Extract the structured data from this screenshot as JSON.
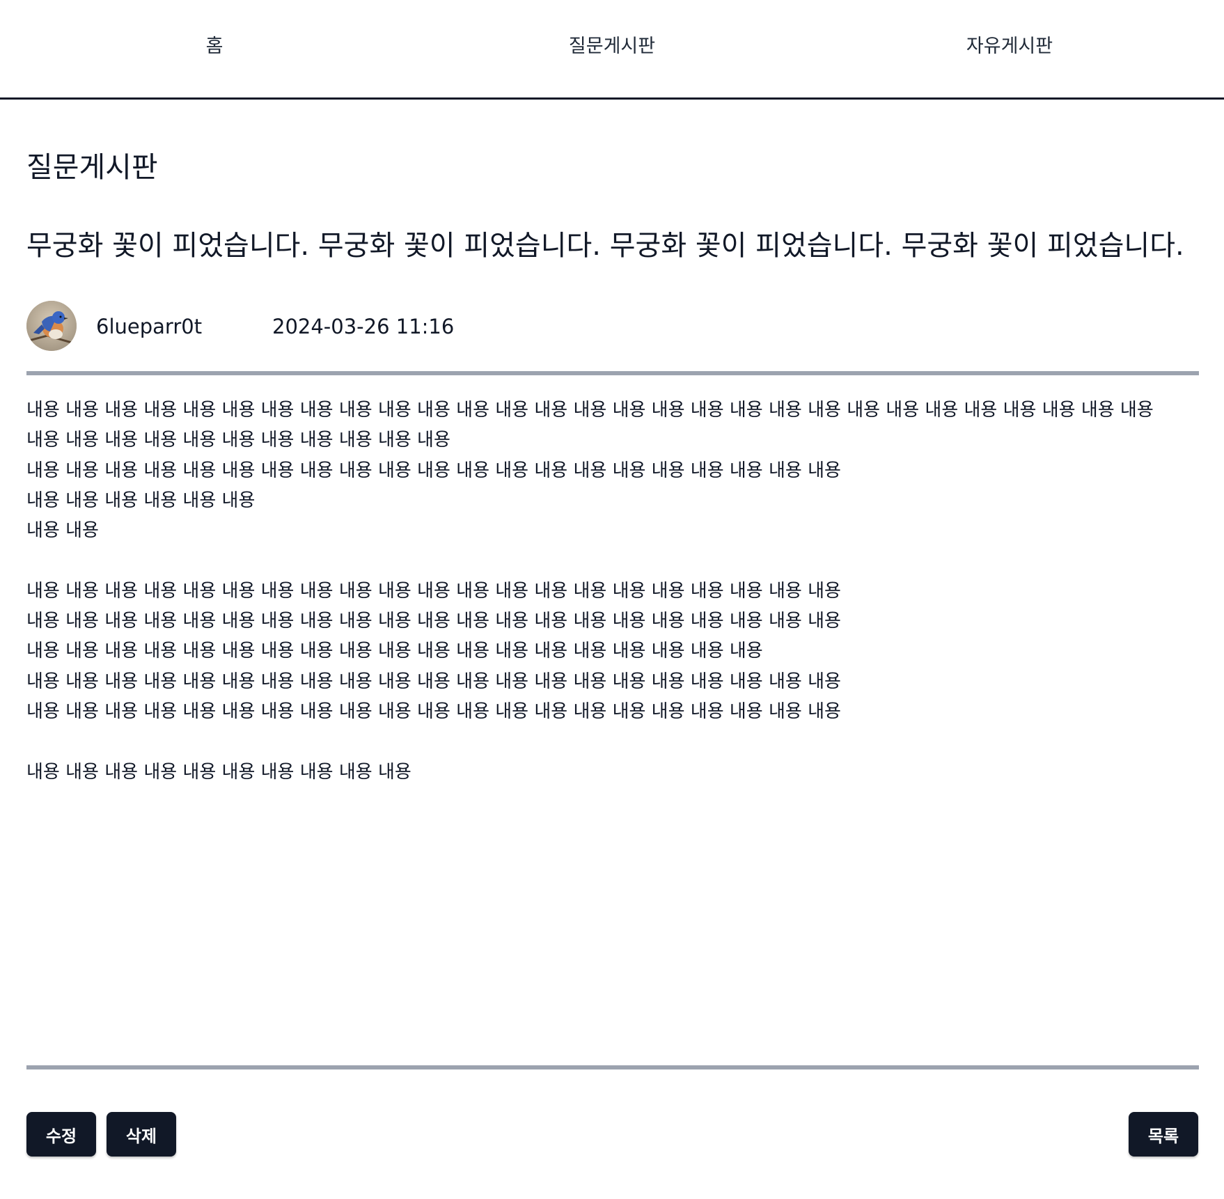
{
  "nav": {
    "items": [
      {
        "label": "홈"
      },
      {
        "label": "질문게시판"
      },
      {
        "label": "자유게시판"
      }
    ]
  },
  "board": {
    "title": "질문게시판"
  },
  "post": {
    "title": "무궁화 꽃이 피었습니다. 무궁화 꽃이 피었습니다. 무궁화 꽃이 피었습니다. 무궁화 꽃이 피었습니다.",
    "author": "6lueparr0t",
    "date": "2024-03-26 11:16",
    "body_lines": [
      "내용 내용 내용 내용 내용 내용 내용 내용 내용 내용 내용 내용 내용 내용 내용 내용 내용 내용 내용 내용 내용 내용 내용 내용 내용 내용 내용 내용 내용",
      "내용 내용 내용 내용 내용 내용 내용 내용 내용 내용 내용",
      "내용 내용 내용 내용 내용 내용 내용 내용 내용 내용 내용 내용 내용 내용 내용 내용 내용 내용 내용 내용 내용",
      "내용 내용 내용 내용 내용 내용",
      "내용 내용",
      "",
      "내용 내용 내용 내용 내용 내용 내용 내용 내용 내용 내용 내용 내용 내용 내용 내용 내용 내용 내용 내용 내용",
      "내용 내용 내용 내용 내용 내용 내용 내용 내용 내용 내용 내용 내용 내용 내용 내용 내용 내용 내용 내용 내용",
      "내용 내용 내용 내용 내용 내용 내용 내용 내용 내용 내용 내용 내용 내용 내용 내용 내용 내용 내용",
      "내용 내용 내용 내용 내용 내용 내용 내용 내용 내용 내용 내용 내용 내용 내용 내용 내용 내용 내용 내용 내용",
      "내용 내용 내용 내용 내용 내용 내용 내용 내용 내용 내용 내용 내용 내용 내용 내용 내용 내용 내용 내용 내용",
      "",
      "내용 내용 내용 내용 내용 내용 내용 내용 내용 내용"
    ]
  },
  "actions": {
    "edit_label": "수정",
    "delete_label": "삭제",
    "list_label": "목록"
  },
  "colors": {
    "primary": "#111827",
    "divider": "#9ca3af",
    "background": "#ffffff"
  },
  "icons": {
    "avatar": "bluebird-avatar"
  }
}
